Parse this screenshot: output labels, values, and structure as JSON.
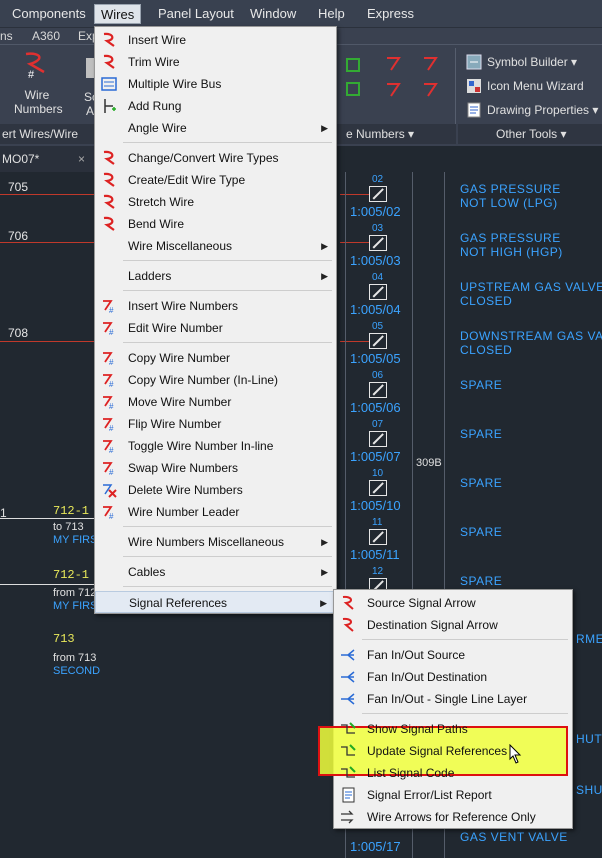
{
  "menubar": {
    "items": [
      "Components",
      "Wires",
      "Panel Layout",
      "Window",
      "Help",
      "Express"
    ]
  },
  "ribbon": {
    "tabs_partial": [
      "ns",
      "A360",
      "Exp"
    ],
    "wire_numbers_label": "Wire\nNumbers",
    "sc_label": "Sc",
    "a_label": "A",
    "panel_left": "ert Wires/Wire Nu",
    "panel_mid": "e Numbers ▾",
    "symbol_builder": "Symbol Builder ▾",
    "icon_menu_wizard": "Icon Menu Wizard",
    "drawing_properties": "Drawing Properties ▾",
    "other_tools": "Other Tools ▾"
  },
  "doc_tab": {
    "label": "MO07*",
    "close": "×"
  },
  "drawing": {
    "wire_numbers": [
      "705",
      "706",
      "708"
    ],
    "left_labels": [
      {
        "num": "1",
        "y_text": "712-1",
        "w_text": "to 713",
        "b_text": "MY FIRST"
      },
      {
        "num": "",
        "y_text": "712-1",
        "w_text": "from 712",
        "b_text": "MY FIRST"
      },
      {
        "num": "",
        "y_text": "713",
        "w_text": "from 713",
        "b_text": "SECOND"
      }
    ],
    "refs": [
      {
        "top": "02",
        "ref": "1:005/02",
        "desc": "GAS PRESSURE\nNOT LOW (LPG)"
      },
      {
        "top": "03",
        "ref": "1:005/03",
        "desc": "GAS PRESSURE\nNOT HIGH (HGP)"
      },
      {
        "top": "04",
        "ref": "1:005/04",
        "desc": "UPSTREAM GAS VALVE\nCLOSED"
      },
      {
        "top": "05",
        "ref": "1:005/05",
        "desc": "DOWNSTREAM GAS VALV\nCLOSED"
      },
      {
        "top": "06",
        "ref": "1:005/06",
        "desc": "SPARE"
      },
      {
        "top": "07",
        "ref": "1:005/07",
        "desc": "SPARE"
      },
      {
        "top": "10",
        "ref": "1:005/10",
        "desc": "SPARE"
      },
      {
        "top": "11",
        "ref": "1:005/11",
        "desc": "SPARE"
      },
      {
        "top": "12",
        "ref": "",
        "desc": "SPARE"
      }
    ],
    "ref_309b": "309B",
    "right_partial": [
      "RMER",
      "HUTO",
      "SHU"
    ],
    "bottom_desc": "GAS VENT VALVE",
    "bottom_ref": "1:005/17"
  },
  "wires_menu": {
    "items": [
      {
        "label": "Insert Wire",
        "icon": "insert-wire-icon",
        "sub": false
      },
      {
        "label": "Trim Wire",
        "icon": "trim-wire-icon",
        "sub": false
      },
      {
        "label": "Multiple Wire Bus",
        "icon": "multiple-wire-bus-icon",
        "sub": false
      },
      {
        "label": "Add Rung",
        "icon": "add-rung-icon",
        "sub": false
      },
      {
        "label": "Angle Wire",
        "icon": "",
        "sub": true
      },
      {
        "sep": true
      },
      {
        "label": "Change/Convert Wire Types",
        "icon": "convert-wire-icon",
        "sub": false
      },
      {
        "label": "Create/Edit Wire Type",
        "icon": "edit-wire-type-icon",
        "sub": false
      },
      {
        "label": "Stretch Wire",
        "icon": "stretch-wire-icon",
        "sub": false
      },
      {
        "label": "Bend Wire",
        "icon": "bend-wire-icon",
        "sub": false
      },
      {
        "label": "Wire Miscellaneous",
        "icon": "",
        "sub": true
      },
      {
        "sep": true
      },
      {
        "label": "Ladders",
        "icon": "",
        "sub": true
      },
      {
        "sep": true
      },
      {
        "label": "Insert Wire Numbers",
        "icon": "insert-wire-numbers-icon",
        "sub": false
      },
      {
        "label": "Edit Wire Number",
        "icon": "edit-wire-number-icon",
        "sub": false
      },
      {
        "sep": true
      },
      {
        "label": "Copy Wire Number",
        "icon": "copy-wire-number-icon",
        "sub": false
      },
      {
        "label": "Copy Wire Number (In-Line)",
        "icon": "copy-inline-icon",
        "sub": false
      },
      {
        "label": "Move Wire Number",
        "icon": "move-wire-number-icon",
        "sub": false
      },
      {
        "label": "Flip Wire Number",
        "icon": "flip-wire-number-icon",
        "sub": false
      },
      {
        "label": "Toggle Wire Number In-line",
        "icon": "toggle-inline-icon",
        "sub": false
      },
      {
        "label": "Swap Wire Numbers",
        "icon": "swap-wire-numbers-icon",
        "sub": false
      },
      {
        "label": "Delete Wire Numbers",
        "icon": "delete-wire-numbers-icon",
        "sub": false
      },
      {
        "label": "Wire Number Leader",
        "icon": "wire-number-leader-icon",
        "sub": false
      },
      {
        "sep": true
      },
      {
        "label": "Wire Numbers Miscellaneous",
        "icon": "",
        "sub": true
      },
      {
        "sep": true
      },
      {
        "label": "Cables",
        "icon": "",
        "sub": true
      },
      {
        "sep": true
      },
      {
        "label": "Signal References",
        "icon": "",
        "sub": true,
        "highlight": true
      }
    ]
  },
  "signal_menu": {
    "items": [
      {
        "label": "Source Signal Arrow",
        "icon": "source-arrow-icon"
      },
      {
        "label": "Destination Signal Arrow",
        "icon": "destination-arrow-icon"
      },
      {
        "sep": true
      },
      {
        "label": "Fan In/Out Source",
        "icon": "fan-source-icon"
      },
      {
        "label": "Fan In/Out Destination",
        "icon": "fan-destination-icon"
      },
      {
        "label": "Fan In/Out - Single Line Layer",
        "icon": "fan-single-line-icon"
      },
      {
        "sep": true
      },
      {
        "label": "Show Signal Paths",
        "icon": "show-paths-icon"
      },
      {
        "label": "Update Signal References",
        "icon": "update-references-icon"
      },
      {
        "label": "List Signal Code",
        "icon": "list-code-icon"
      },
      {
        "label": "Signal Error/List Report",
        "icon": "error-report-icon"
      },
      {
        "label": "Wire Arrows for Reference Only",
        "icon": "wire-arrows-icon"
      }
    ]
  },
  "colors": {
    "menu_bg": "#f0f0f0",
    "highlight_fill": "#f0ff3c",
    "highlight_border": "#dd1111",
    "cad_blue": "#3ba3ff",
    "cad_yellow": "#e8e85a"
  }
}
